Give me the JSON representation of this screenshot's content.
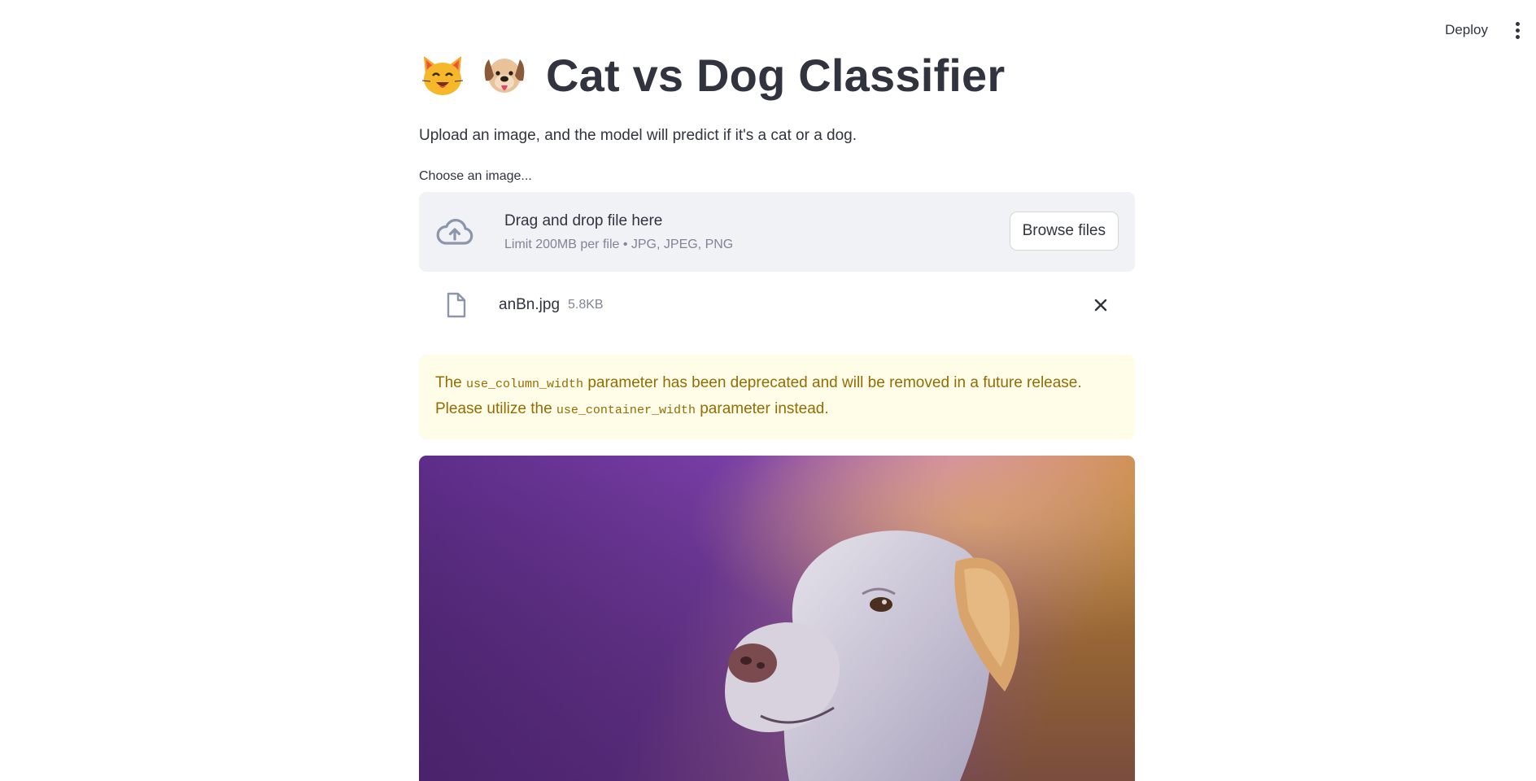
{
  "header": {
    "deploy_label": "Deploy",
    "menu_icon": "kebab-menu-icon"
  },
  "main": {
    "title": "Cat vs Dog Classifier",
    "title_emojis": [
      "cat-face-emoji",
      "dog-face-emoji"
    ],
    "subtitle": "Upload an image, and the model will predict if it's a cat or a dog.",
    "uploader": {
      "label": "Choose an image...",
      "dropzone_title": "Drag and drop file here",
      "dropzone_hint": "Limit 200MB per file • JPG, JPEG, PNG",
      "browse_label": "Browse files",
      "icon": "cloud-upload-icon"
    },
    "uploaded_file": {
      "name": "anBn.jpg",
      "size": "5.8KB",
      "icon": "file-icon",
      "remove_icon": "close-icon"
    },
    "warning": {
      "part1": "The ",
      "code1": "use_column_width",
      "part2": " parameter has been deprecated and will be removed in a future release. Please utilize the ",
      "code2": "use_container_width",
      "part3": " parameter instead."
    },
    "image": {
      "subject": "dog-photo"
    }
  },
  "colors": {
    "text": "#31333f",
    "muted": "#808495",
    "dropzone_bg": "#f0f2f6",
    "warning_bg": "#fffce7",
    "warning_text": "#926c05"
  }
}
